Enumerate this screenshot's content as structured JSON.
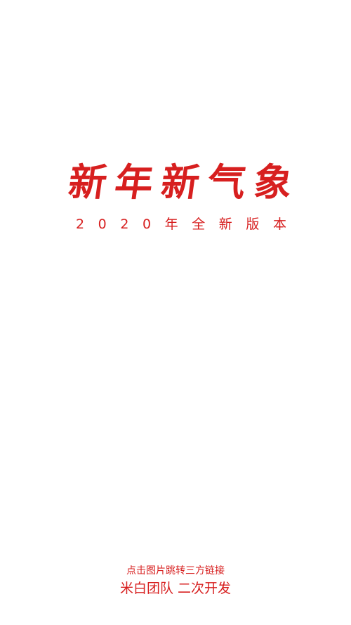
{
  "splash": {
    "title_chars": [
      "新",
      "年",
      "新",
      "气",
      "象"
    ],
    "subtitle_chars": [
      "2",
      "0",
      "2",
      "0",
      "年",
      "全",
      "新",
      "版",
      "本"
    ],
    "link_hint": "点击图片跳转三方链接",
    "credit": "米白团队 二次开发",
    "accent_color": "#d71f1f",
    "background_color": "#ffffff"
  }
}
